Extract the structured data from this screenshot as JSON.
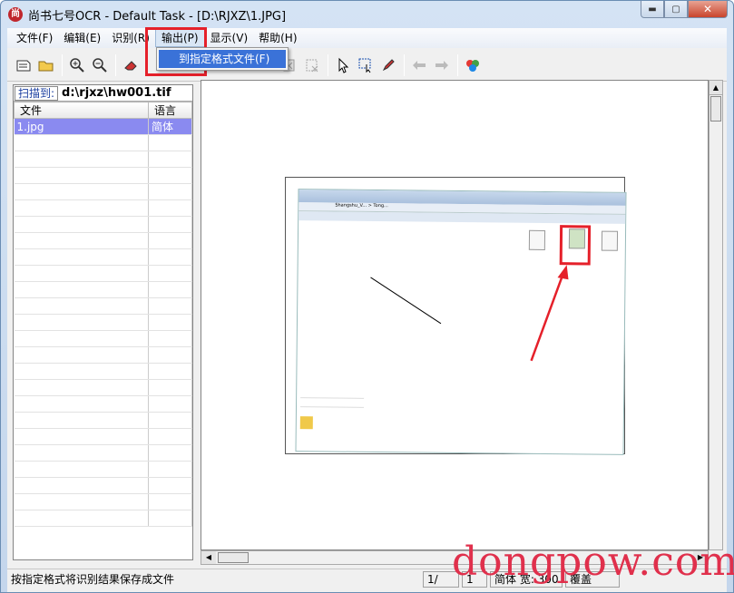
{
  "window": {
    "title": "尚书七号OCR - Default Task - [D:\\RJXZ\\1.JPG]",
    "min_glyph": "▬",
    "max_glyph": "▢",
    "close_glyph": "✕"
  },
  "menubar": {
    "items": [
      "文件(F)",
      "编辑(E)",
      "识别(R)",
      "输出(P)",
      "显示(V)",
      "帮助(H)"
    ],
    "active_index": 3
  },
  "dropdown": {
    "item": "到指定格式文件(F)"
  },
  "toolbar": {
    "icons": [
      "open-scan-icon",
      "open-folder-icon",
      "zoom-in-icon",
      "zoom-out-icon",
      "eraser-icon",
      "delete-region-icon",
      "remove-icon",
      "pointer-icon",
      "select-region-icon",
      "pen-icon",
      "back-arrow-icon",
      "forward-arrow-icon",
      "color-icon"
    ]
  },
  "left_panel": {
    "scan_label": "扫描到:",
    "scan_path": "d:\\rjxz\\hw001.tif",
    "columns": [
      "文件",
      "语言"
    ],
    "rows": [
      {
        "file": "1.jpg",
        "lang": "简体"
      }
    ]
  },
  "document_preview": {
    "explorer_path": "Shangshu_V... > Tong..."
  },
  "statusbar": {
    "hint": "按指定格式将识别结果保存成文件",
    "page": "1/",
    "count": "1",
    "res": "简体 宽: 300",
    "mode": "覆盖"
  },
  "watermark": "dongpow.com",
  "colors": {
    "highlight": "#e5202a",
    "selected_row": "#8a8af0",
    "menu_select": "#3a72d8"
  }
}
